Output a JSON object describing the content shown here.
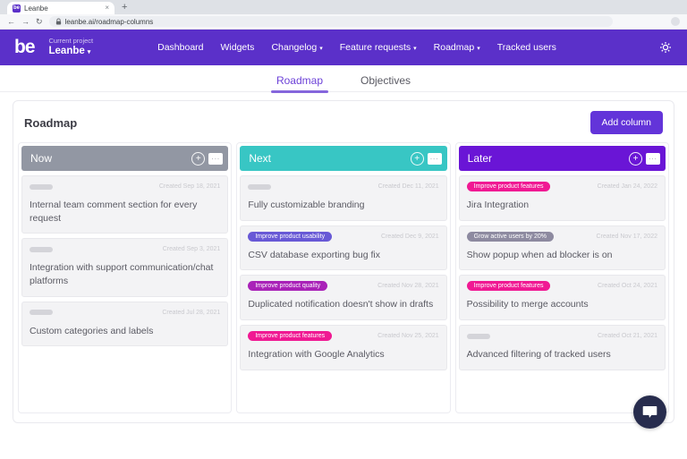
{
  "browser": {
    "tab_title": "Leanbe",
    "favicon_text": "be",
    "url": "leanbe.ai/roadmap-columns",
    "close_glyph": "×",
    "new_tab_glyph": "+",
    "back_glyph": "←",
    "forward_glyph": "→",
    "reload_glyph": "↻"
  },
  "navbar": {
    "logo_text": "be",
    "project_label": "Current project",
    "project_name": "Leanbe",
    "caret_glyph": "▾",
    "items": [
      {
        "label": "Dashboard",
        "dropdown": false
      },
      {
        "label": "Widgets",
        "dropdown": false
      },
      {
        "label": "Changelog",
        "dropdown": true
      },
      {
        "label": "Feature requests",
        "dropdown": true
      },
      {
        "label": "Roadmap",
        "dropdown": true
      },
      {
        "label": "Tracked users",
        "dropdown": false
      }
    ],
    "icons": {
      "settings": "gear"
    }
  },
  "subtabs": [
    {
      "label": "Roadmap",
      "active": true
    },
    {
      "label": "Objectives",
      "active": false
    }
  ],
  "board": {
    "title": "Roadmap",
    "add_column_label": "Add column",
    "lane_icons": {
      "add_card": "plus-circle",
      "menu": "ellipsis"
    },
    "ellipsis_glyph": "...",
    "plus_glyph": "+",
    "columns": [
      {
        "name": "Now",
        "color": "#9297a3",
        "cards": [
          {
            "tag": null,
            "date": "Created Sep 18, 2021",
            "text": "Internal team comment section for every request"
          },
          {
            "tag": null,
            "date": "Created Sep 3, 2021",
            "text": "Integration with support communication/chat platforms"
          },
          {
            "tag": null,
            "date": "Created Jul 28, 2021",
            "text": "Custom categories and labels"
          }
        ]
      },
      {
        "name": "Next",
        "color": "#38c6c4",
        "cards": [
          {
            "tag": null,
            "date": "Created Dec 11, 2021",
            "text": "Fully customizable branding"
          },
          {
            "tag": {
              "label": "Improve product usability",
              "color": "#6859d6"
            },
            "date": "Created Dec 9, 2021",
            "text": "CSV database exporting bug fix"
          },
          {
            "tag": {
              "label": "Improve product quality",
              "color": "#a922b8"
            },
            "date": "Created Nov 28, 2021",
            "text": "Duplicated notification doesn't show in drafts"
          },
          {
            "tag": {
              "label": "Improve product features",
              "color": "#f01993"
            },
            "date": "Created Nov 25, 2021",
            "text": "Integration with Google Analytics"
          }
        ]
      },
      {
        "name": "Later",
        "color": "#6a15d6",
        "cards": [
          {
            "tag": {
              "label": "Improve product features",
              "color": "#f01993"
            },
            "date": "Created Jan 24, 2022",
            "text": "Jira Integration"
          },
          {
            "tag": {
              "label": "Grow active users by 20%",
              "color": "#8d8aa0"
            },
            "date": "Created Nov 17, 2022",
            "text": "Show popup when ad blocker is on"
          },
          {
            "tag": {
              "label": "Improve product features",
              "color": "#f01993"
            },
            "date": "Created Oct 24, 2021",
            "text": "Possibility to merge accounts"
          },
          {
            "tag": null,
            "date": "Created Oct 21, 2021",
            "text": "Advanced filtering of tracked users"
          }
        ]
      }
    ]
  },
  "chat": {
    "icon": "chat-bubble"
  }
}
